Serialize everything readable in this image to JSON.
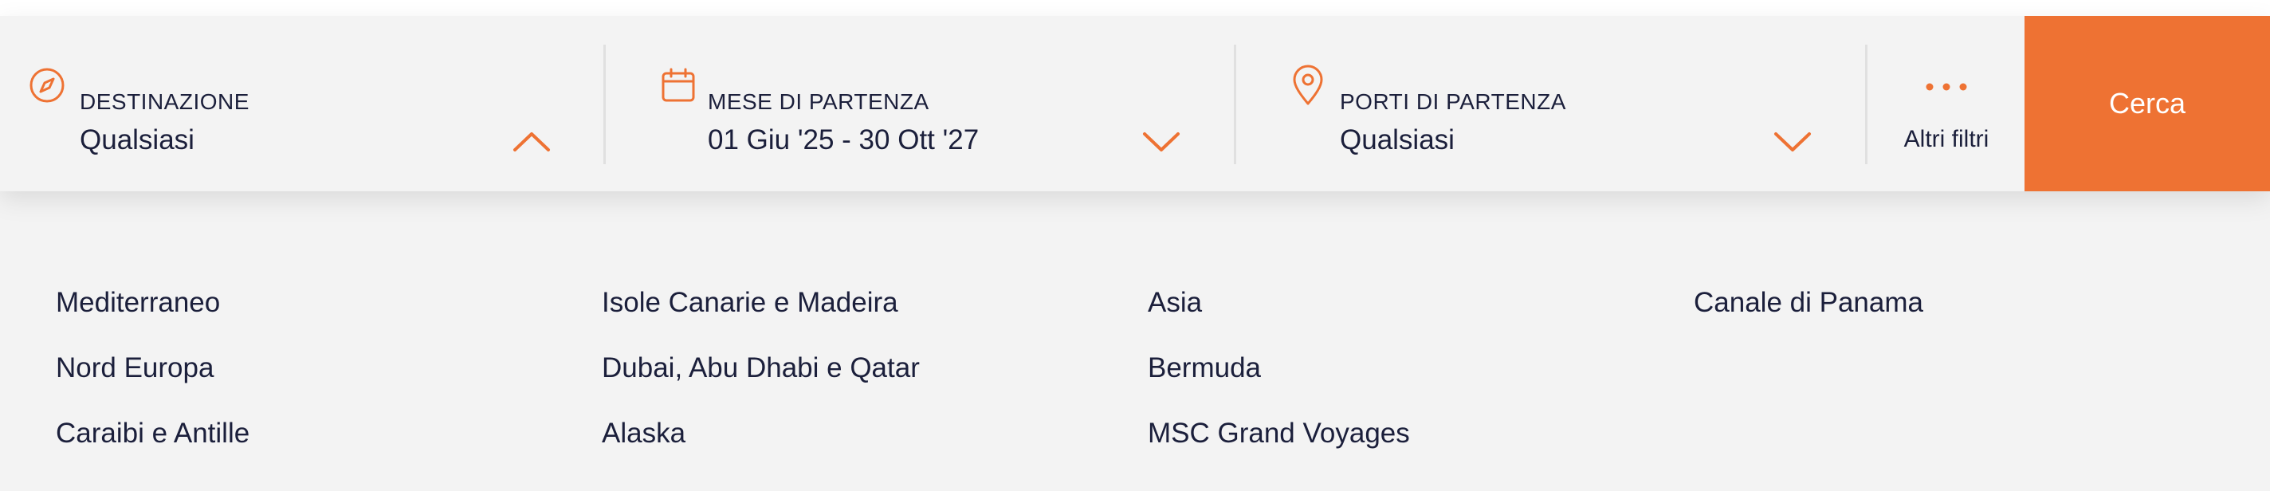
{
  "search": {
    "destination": {
      "label": "DESTINAZIONE",
      "value": "Qualsiasi",
      "icon": "compass-icon",
      "chevron": "chevron-up-icon"
    },
    "departure_month": {
      "label": "MESE DI PARTENZA",
      "value": "01 Giu '25 - 30 Ott '27",
      "icon": "calendar-icon",
      "chevron": "chevron-down-icon"
    },
    "departure_port": {
      "label": "PORTI DI PARTENZA",
      "value": "Qualsiasi",
      "icon": "location-pin-icon",
      "chevron": "chevron-down-icon"
    },
    "more_filters": {
      "label": "Altri filtri",
      "icon": "more-dots-icon"
    },
    "search_button": {
      "label": "Cerca"
    }
  },
  "destinations": {
    "columns": [
      [
        "Mediterraneo",
        "Nord Europa",
        "Caraibi e Antille"
      ],
      [
        "Isole Canarie e Madeira",
        "Dubai, Abu Dhabi e Qatar",
        "Alaska"
      ],
      [
        "Asia",
        "Bermuda",
        "MSC Grand Voyages"
      ],
      [
        "Canale di Panama"
      ]
    ]
  },
  "colors": {
    "accent": "#ee7233",
    "text": "#1b1f3b",
    "background": "#f3f3f3"
  }
}
